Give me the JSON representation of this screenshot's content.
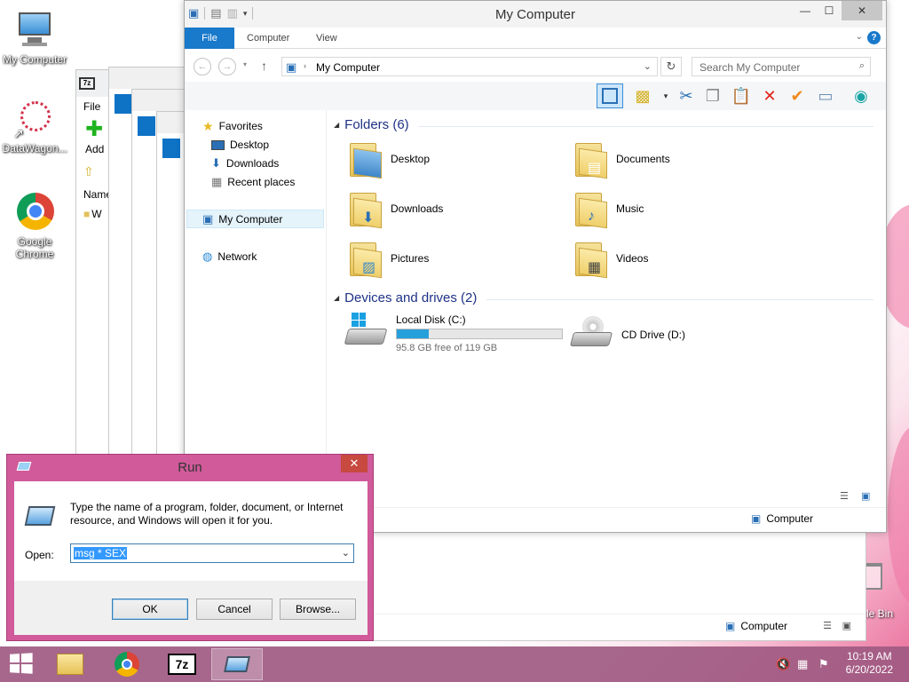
{
  "desktop": {
    "icons": [
      {
        "label": "My Computer",
        "icon": "computer-icon"
      },
      {
        "label": "DataWagon...",
        "icon": "datawagon-icon"
      },
      {
        "label": "Google Chrome",
        "icon": "chrome-icon"
      }
    ],
    "recycle_label": "cle Bin"
  },
  "bg_window_7z": {
    "file_menu": "File",
    "add_label": "Add",
    "name_header": "Name",
    "row_prefix": "W"
  },
  "bg_window2": {
    "status_computer": "Computer"
  },
  "explorer": {
    "title": "My Computer",
    "tabs": [
      "File",
      "Computer",
      "View"
    ],
    "address": "My Computer",
    "search_placeholder": "Search My Computer",
    "nav": {
      "favorites": "Favorites",
      "desktop": "Desktop",
      "downloads": "Downloads",
      "recent": "Recent places",
      "mycomputer": "My Computer",
      "network": "Network"
    },
    "folders_header": "Folders (6)",
    "folders": [
      "Desktop",
      "Documents",
      "Downloads",
      "Music",
      "Pictures",
      "Videos"
    ],
    "devices_header": "Devices and drives (2)",
    "drives": [
      {
        "name": "Local Disk (C:)",
        "free": "95.8 GB free of 119 GB",
        "used_fraction": 0.195
      },
      {
        "name": "CD Drive (D:)"
      }
    ],
    "status_computer": "Computer"
  },
  "run": {
    "title": "Run",
    "description": "Type the name of a program, folder, document, or Internet resource, and Windows will open it for you.",
    "open_label": "Open:",
    "open_value": "msg * SEX",
    "ok": "OK",
    "cancel": "Cancel",
    "browse": "Browse..."
  },
  "taskbar": {
    "time": "10:19 AM",
    "date": "6/20/2022"
  },
  "colors": {
    "accent": "#1979ca",
    "run_frame": "#d05a9a",
    "taskbar": "#a05a82"
  }
}
